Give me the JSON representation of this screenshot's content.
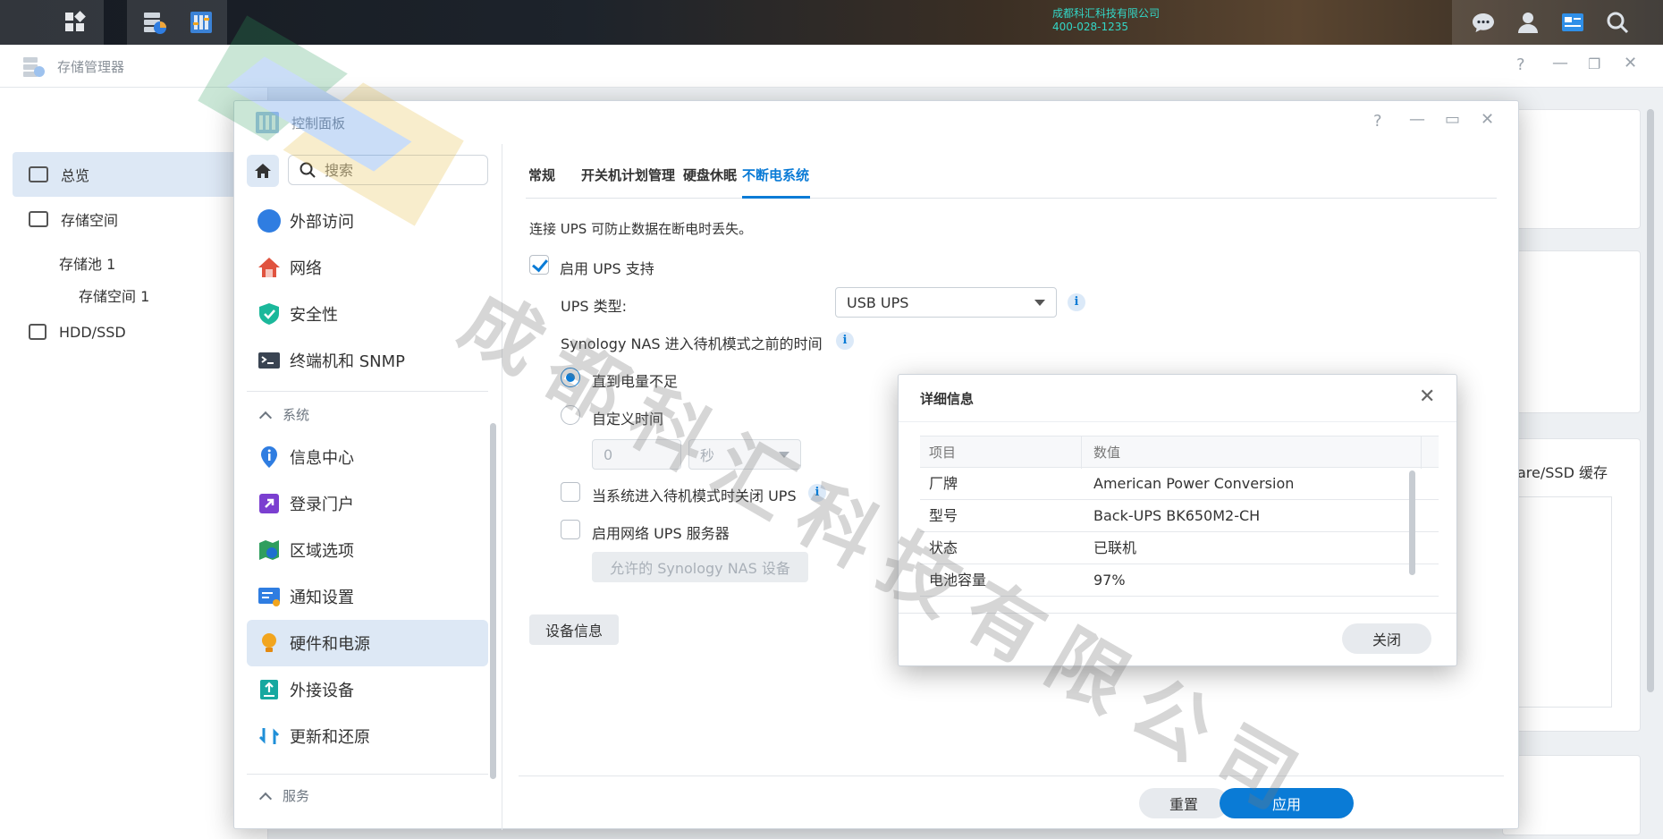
{
  "taskbar": {
    "company_name": "成都科汇科技有限公司",
    "company_phone": "400-028-1235"
  },
  "storage_manager": {
    "title": "存储管理器",
    "nav": [
      {
        "label": "总览"
      },
      {
        "label": "存储空间"
      },
      {
        "label": "存储池 1"
      },
      {
        "label": "存储空间 1"
      },
      {
        "label": "HDD/SSD"
      }
    ],
    "partial_text": "are/SSD 缓存"
  },
  "control_panel": {
    "title": "控制面板",
    "search": {
      "placeholder": "搜索",
      "value": ""
    },
    "nav": {
      "items_top": [
        {
          "label": "外部访问",
          "icon": "external-access-icon",
          "color": "#2f7de1"
        },
        {
          "label": "网络",
          "icon": "network-home-icon",
          "color": "#e0533f"
        },
        {
          "label": "安全性",
          "icon": "shield-icon",
          "color": "#1bb89b"
        },
        {
          "label": "终端机和 SNMP",
          "icon": "terminal-icon",
          "color": "#3a4452"
        }
      ],
      "group_system": "系统",
      "items_system": [
        {
          "label": "信息中心",
          "icon": "info-pin-icon",
          "color": "#2f7de1"
        },
        {
          "label": "登录门户",
          "icon": "login-portal-icon",
          "color": "#7b3fd0"
        },
        {
          "label": "区域选项",
          "icon": "region-map-icon",
          "color": "#2f9e5e"
        },
        {
          "label": "通知设置",
          "icon": "notification-icon",
          "color": "#2f7de1"
        },
        {
          "label": "硬件和电源",
          "icon": "lightbulb-icon",
          "color": "#f2a51e"
        },
        {
          "label": "外接设备",
          "icon": "external-device-icon",
          "color": "#17a8a0"
        },
        {
          "label": "更新和还原",
          "icon": "update-restore-icon",
          "color": "#1f8fd8"
        }
      ],
      "group_services": "服务"
    },
    "tabs": [
      {
        "label": "常规"
      },
      {
        "label": "开关机计划管理"
      },
      {
        "label": "硬盘休眠"
      },
      {
        "label": "不断电系统"
      }
    ],
    "ups": {
      "description": "连接 UPS 可防止数据在断电时丢失。",
      "enable_label": "启用 UPS 支持",
      "type_label": "UPS 类型:",
      "type_value": "USB UPS",
      "standby_label": "Synology NAS 进入待机模式之前的时间",
      "option_low_battery": "直到电量不足",
      "option_custom_time": "自定义时间",
      "custom_value": "0",
      "custom_unit": "秒",
      "shutdown_label": "当系统进入待机模式时关闭 UPS",
      "network_server_label": "启用网络 UPS 服务器",
      "allowed_devices_button": "允许的 Synology NAS 设备",
      "device_info_button": "设备信息"
    },
    "footer": {
      "reset_button": "重置",
      "apply_button": "应用"
    }
  },
  "detail_dialog": {
    "title": "详细信息",
    "columns": [
      "项目",
      "数值"
    ],
    "rows": [
      {
        "item": "厂牌",
        "value": "American Power Conversion"
      },
      {
        "item": "型号",
        "value": "Back-UPS BK650M2-CH"
      },
      {
        "item": "状态",
        "value": "已联机"
      },
      {
        "item": "电池容量",
        "value": "97%"
      }
    ],
    "close_button": "关闭"
  },
  "watermark": {
    "text": "成都科汇科技有限公司"
  },
  "colors": {
    "accent": "#0a7bd6",
    "nav_active": "#dde8f5"
  }
}
